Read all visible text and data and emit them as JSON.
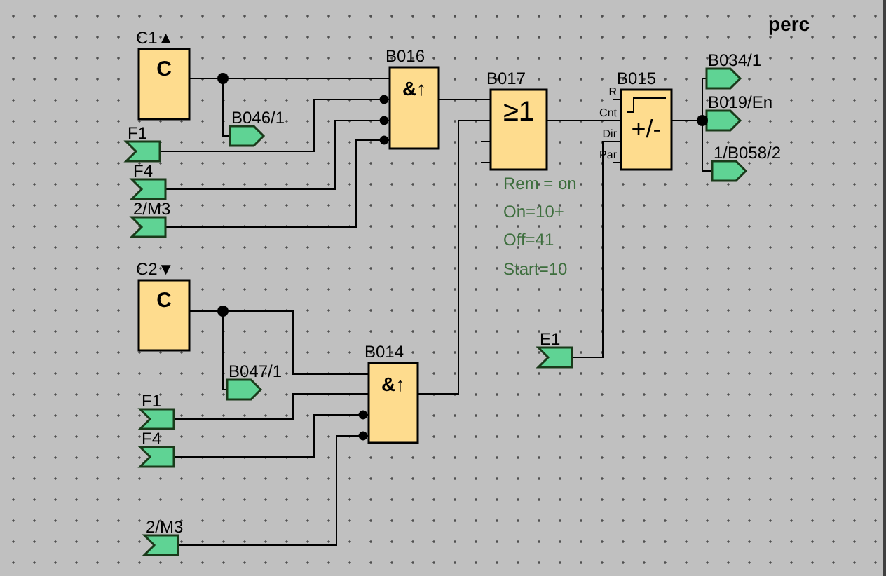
{
  "title": "perc",
  "cursor_keys": [
    {
      "label": "C1▲",
      "symbol": "C"
    },
    {
      "label": "C2▼",
      "symbol": "C"
    }
  ],
  "blocks": [
    {
      "name": "B016",
      "kind": "and_edge",
      "symbol": "&↑"
    },
    {
      "name": "B017",
      "kind": "or",
      "symbol": "≥1"
    },
    {
      "name": "B015",
      "kind": "updown",
      "symbol": "+/-",
      "pins": [
        "R",
        "Cnt",
        "Dir",
        "Par"
      ]
    },
    {
      "name": "B014",
      "kind": "and_edge",
      "symbol": "&↑"
    }
  ],
  "inputs": [
    {
      "label": "F1"
    },
    {
      "label": "F4"
    },
    {
      "label": "2/M3"
    },
    {
      "label": "E1"
    },
    {
      "label": "F1"
    },
    {
      "label": "F4"
    },
    {
      "label": "2/M3"
    }
  ],
  "outputs": [
    {
      "label": "B046/1"
    },
    {
      "label": "B034/1"
    },
    {
      "label": "B019/En"
    },
    {
      "label": "1/B058/2"
    },
    {
      "label": "B047/1"
    }
  ],
  "parameters": [
    "Rem = on",
    "On=10+",
    "Off=41",
    "Start=10"
  ]
}
